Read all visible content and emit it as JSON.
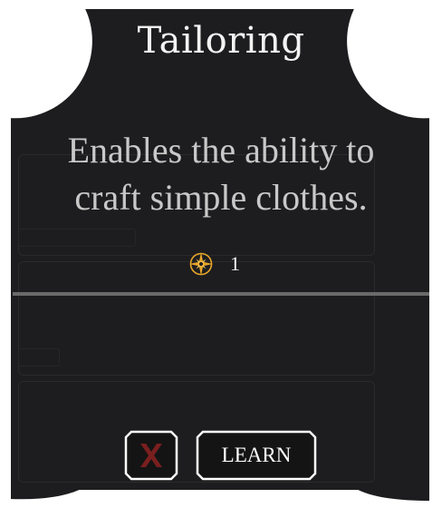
{
  "dialog": {
    "title": "Tailoring",
    "description": "Enables the ability to craft simple clothes.",
    "cost": {
      "icon": "compass-star-icon",
      "value": "1"
    },
    "buttons": {
      "close_icon": "close-x-icon",
      "learn_label": "LEARN"
    }
  },
  "colors": {
    "panel": "#1d1d1f",
    "border": "#ffffff",
    "divider": "#6a6a6a",
    "close_x": "#7a1f1f",
    "cost_icon": "#e8a629"
  }
}
